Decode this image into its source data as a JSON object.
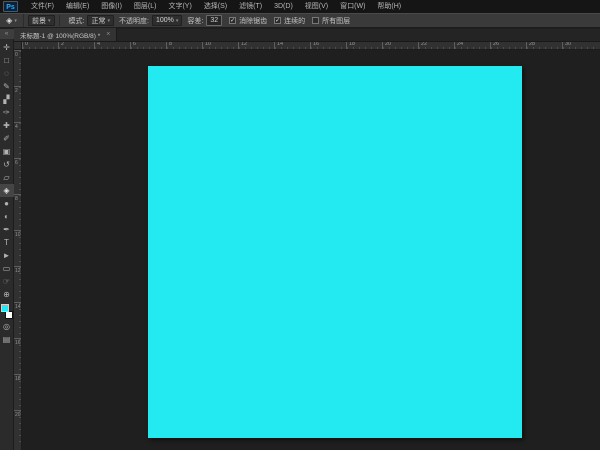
{
  "app": {
    "logo": "Ps"
  },
  "menubar": {
    "items": [
      "文件(F)",
      "编辑(E)",
      "图像(I)",
      "图层(L)",
      "文字(Y)",
      "选择(S)",
      "滤镜(T)",
      "3D(D)",
      "视图(V)",
      "窗口(W)",
      "帮助(H)"
    ]
  },
  "icons": {
    "caret": "▾",
    "check": "✓"
  },
  "options_bar": {
    "tool_glyph": "◈",
    "tool_name": "paint-bucket",
    "fill_source": "前景",
    "mode_label": "模式:",
    "mode_value": "正常",
    "opacity_label": "不透明度:",
    "opacity_value": "100%",
    "tolerance_label": "容差:",
    "tolerance_value": "32",
    "checkboxes": [
      {
        "name": "anti-alias",
        "label": "消除锯齿",
        "checked": true
      },
      {
        "name": "contiguous",
        "label": "连续的",
        "checked": true
      },
      {
        "name": "all-layers",
        "label": "所有图层",
        "checked": false
      }
    ]
  },
  "document_tab": {
    "title": "未标题-1 @ 100%(RGB/8) *",
    "close": "×"
  },
  "rulers": {
    "horizontal": [
      "0",
      "2",
      "4",
      "6",
      "8",
      "10",
      "12",
      "14",
      "16",
      "18",
      "20",
      "22",
      "24",
      "26",
      "28",
      "30"
    ],
    "vertical": [
      "0",
      "2",
      "4",
      "6",
      "8",
      "10",
      "12",
      "14",
      "16",
      "18",
      "20"
    ]
  },
  "toolbar": {
    "collapse": "«",
    "tools": [
      {
        "name": "move",
        "glyph": "✛"
      },
      {
        "name": "marquee",
        "glyph": "□"
      },
      {
        "name": "lasso",
        "glyph": "◌"
      },
      {
        "name": "quick-selection",
        "glyph": "✎"
      },
      {
        "name": "crop",
        "glyph": "▞"
      },
      {
        "name": "eyedropper",
        "glyph": "✑"
      },
      {
        "name": "healing-brush",
        "glyph": "✚"
      },
      {
        "name": "brush",
        "glyph": "✐"
      },
      {
        "name": "clone-stamp",
        "glyph": "▣"
      },
      {
        "name": "history-brush",
        "glyph": "↺"
      },
      {
        "name": "eraser",
        "glyph": "▱"
      },
      {
        "name": "paint-bucket",
        "glyph": "◈",
        "active": true
      },
      {
        "name": "blur",
        "glyph": "●"
      },
      {
        "name": "dodge",
        "glyph": "◐"
      },
      {
        "name": "pen",
        "glyph": "✒"
      },
      {
        "name": "type",
        "glyph": "T"
      },
      {
        "name": "path-selection",
        "glyph": "►"
      },
      {
        "name": "shape",
        "glyph": "▭"
      },
      {
        "name": "hand",
        "glyph": "☞"
      },
      {
        "name": "zoom",
        "glyph": "⊕"
      }
    ],
    "quick_mask_glyph": "◎",
    "screen_mode_glyph": "▤"
  },
  "colors": {
    "foreground": "#23e9f1",
    "background": "#ffffff",
    "canvas": "#23e9f1",
    "logo_accent": "#37a6ea"
  }
}
